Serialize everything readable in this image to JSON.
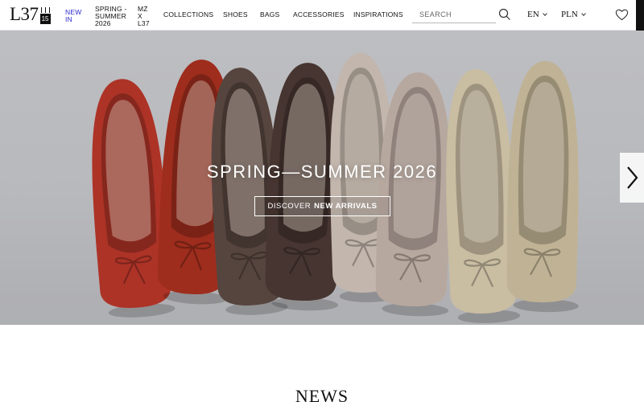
{
  "brand": {
    "logo_text": "L37",
    "badge_text": "15"
  },
  "nav": {
    "new_in": "NEW IN",
    "spring_summer": "SPRING - SUMMER 2026",
    "mz": "MŻ X L37",
    "collections": "COLLECTIONS",
    "shoes": "SHOES",
    "bags": "BAGS",
    "accessories": "ACCESSORIES",
    "inspirations": "INSPIRATIONS"
  },
  "search": {
    "placeholder": "SEARCH",
    "value": ""
  },
  "language": {
    "selected": "EN"
  },
  "currency": {
    "selected": "PLN"
  },
  "hero": {
    "title": "SPRING—SUMMER 2026",
    "cta_prefix": "DISCOVER",
    "cta_bold": "NEW ARRIVALS",
    "shoe_colors": [
      "#b8372a",
      "#a8301f",
      "#5c4a42",
      "#4b3934",
      "#cfc2b8",
      "#c3b3a9",
      "#d6c9ad",
      "#cdbf9f"
    ]
  },
  "sections": {
    "news_title": "NEWS"
  },
  "colors": {
    "accent": "#2b2bd0",
    "text": "#111111"
  }
}
